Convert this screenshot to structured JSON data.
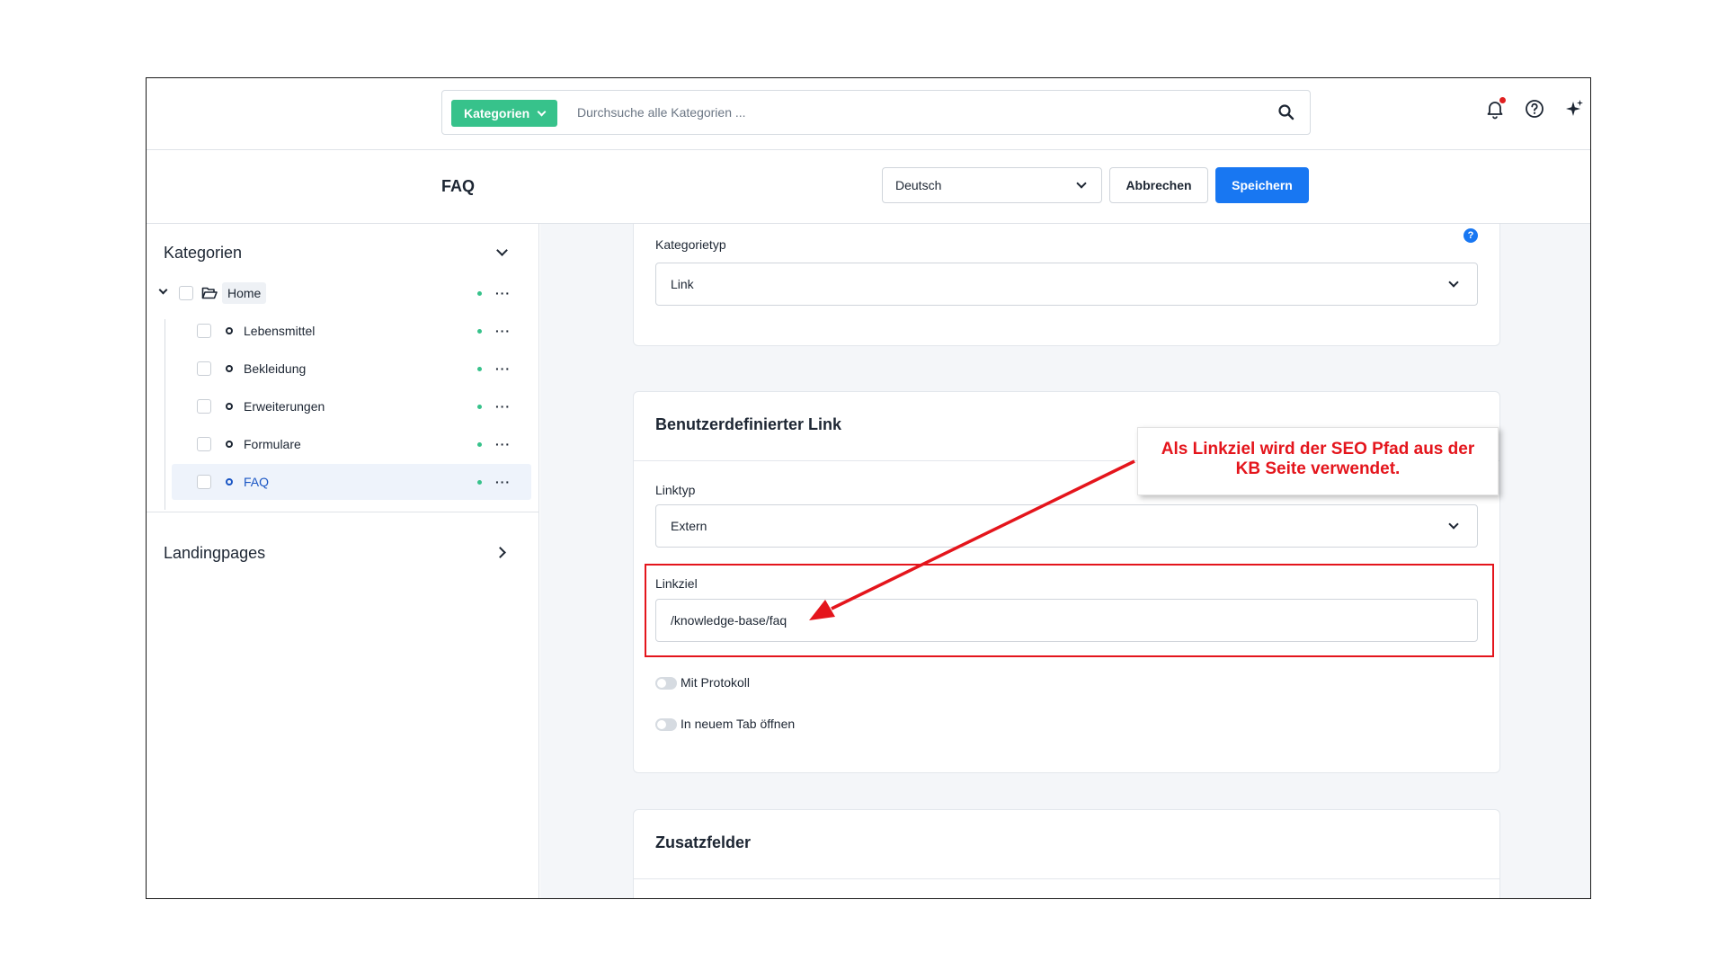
{
  "search": {
    "category_label": "Kategorien",
    "placeholder": "Durchsuche alle Kategorien ..."
  },
  "header": {
    "title": "FAQ",
    "language": "Deutsch",
    "cancel_label": "Abbrechen",
    "save_label": "Speichern"
  },
  "sidebar": {
    "categories_title": "Kategorien",
    "root": {
      "label": "Home"
    },
    "items": [
      {
        "label": "Lebensmittel",
        "active": false
      },
      {
        "label": "Bekleidung",
        "active": false
      },
      {
        "label": "Erweiterungen",
        "active": false
      },
      {
        "label": "Formulare",
        "active": false
      },
      {
        "label": "FAQ",
        "active": true
      }
    ],
    "landingpages_title": "Landingpages",
    "more_glyph": "···"
  },
  "main": {
    "category_type": {
      "label": "Kategorietyp",
      "value": "Link",
      "info_glyph": "?"
    },
    "custom_link": {
      "title": "Benutzerdefinierter Link",
      "link_type_label": "Linktyp",
      "link_type_value": "Extern",
      "link_target_label": "Linkziel",
      "link_target_value": "/knowledge-base/faq",
      "protocol_label": "Mit Protokoll",
      "new_tab_label": "In neuem Tab öffnen"
    },
    "extra_fields": {
      "title": "Zusatzfelder"
    }
  },
  "annotation": {
    "callout_line1": "Als Linkziel wird der SEO Pfad aus der",
    "callout_line2": "KB Seite verwendet.",
    "color": "#e4151c"
  },
  "colors": {
    "accent_green": "#37c28b",
    "primary_blue": "#1877f2"
  }
}
